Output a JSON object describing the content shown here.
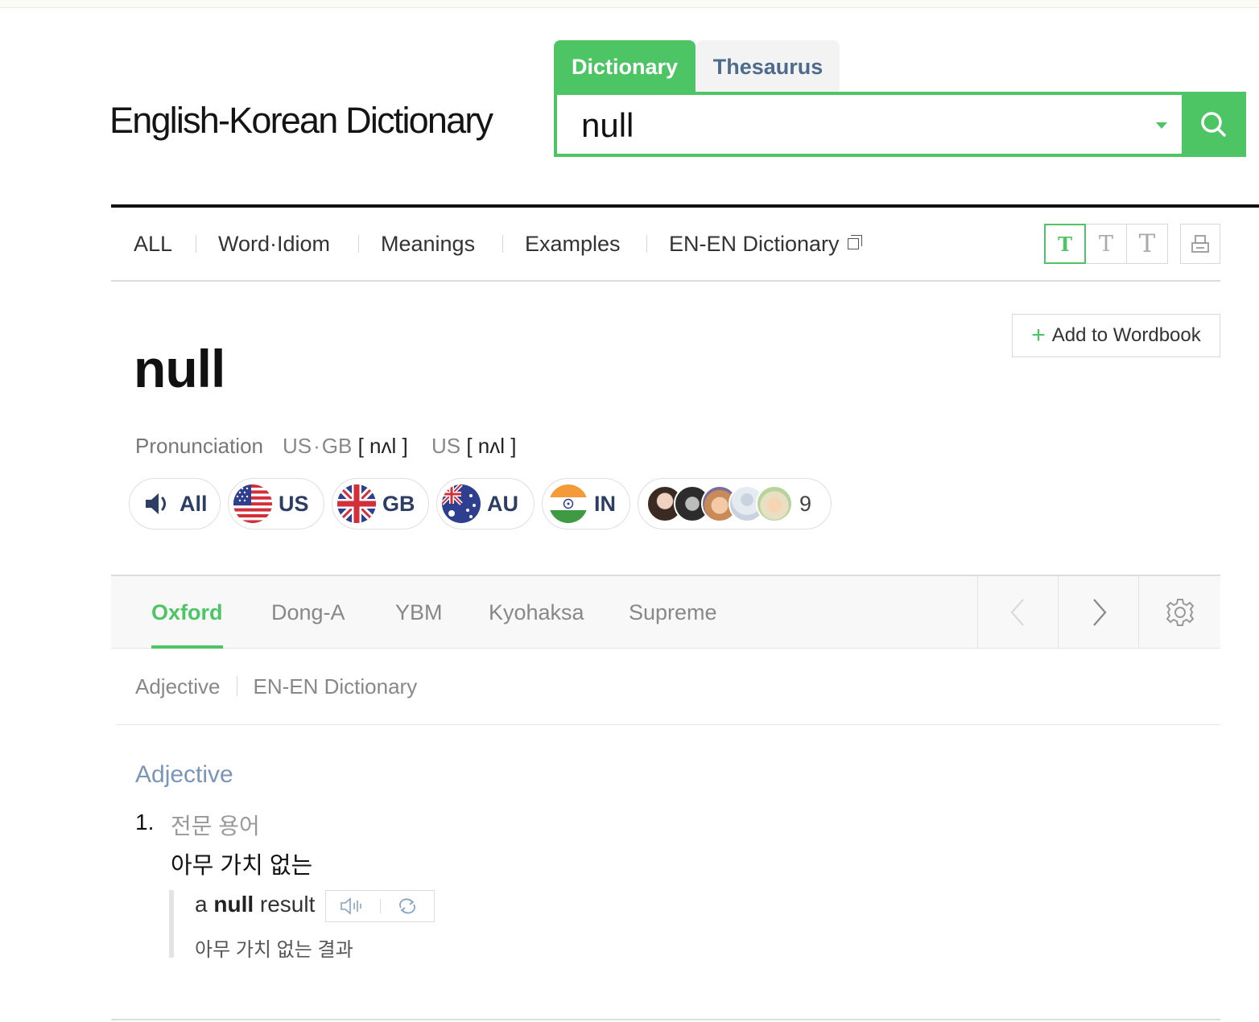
{
  "header": {
    "logo": "English-Korean Dictionary",
    "tabs": {
      "dictionary": "Dictionary",
      "thesaurus": "Thesaurus"
    },
    "search": {
      "value": "null"
    }
  },
  "category_nav": {
    "items": [
      "ALL",
      "Word·Idiom",
      "Meanings",
      "Examples",
      "EN-EN Dictionary"
    ],
    "font_size_buttons": [
      "T",
      "T",
      "T"
    ]
  },
  "entry": {
    "wordbook_label": "Add to Wordbook",
    "headword": "null",
    "pronunciation": {
      "label": "Pronunciation",
      "region1": "US",
      "region2": "GB",
      "ipa1": "[ nʌl ]",
      "region3": "US",
      "ipa2": "[ nʌl ]"
    },
    "audio": {
      "all": "All",
      "us": "US",
      "gb": "GB",
      "au": "AU",
      "in": "IN",
      "user_count": "9"
    }
  },
  "dictionary_tabs": [
    "Oxford",
    "Dong-A",
    "YBM",
    "Kyohaksa",
    "Supreme"
  ],
  "pos_nav": [
    "Adjective",
    "EN-EN Dictionary"
  ],
  "definition": {
    "pos": "Adjective",
    "number": "1.",
    "field": "전문 용어",
    "meaning": "아무 가치 없는",
    "example": {
      "pre": "a",
      "keyword": "null",
      "post": "result",
      "translation": "아무 가치 없는 결과"
    }
  },
  "colors": {
    "accent": "#4ec565",
    "tab_inactive_text": "#4f6b8b",
    "pos_title": "#7a95b8",
    "pill_text": "#2e3d64"
  },
  "icons": [
    "search-icon",
    "chevron-down-icon",
    "new-window-icon",
    "print-icon",
    "plus-icon",
    "speaker-icon",
    "us-flag-icon",
    "gb-flag-icon",
    "au-flag-icon",
    "in-flag-icon",
    "chevron-left-icon",
    "chevron-right-icon",
    "gear-icon",
    "sound-wave-icon",
    "repeat-icon"
  ]
}
